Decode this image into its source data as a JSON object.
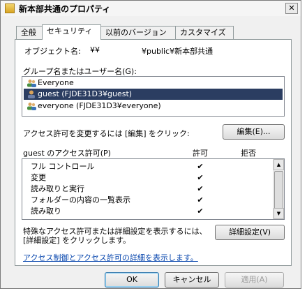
{
  "window": {
    "title": "新本部共通のプロパティ",
    "close_glyph": "✕"
  },
  "tabs": [
    {
      "label": "全般"
    },
    {
      "label": "セキュリティ"
    },
    {
      "label": "以前のバージョン"
    },
    {
      "label": "カスタマイズ"
    }
  ],
  "security": {
    "object_label": "オブジェクト名:",
    "object_prefix": "¥¥",
    "object_suffix": "¥public¥新本部共通",
    "groups_label": "グループ名またはユーザー名(G):",
    "groups": [
      {
        "name": "Everyone",
        "selected": false
      },
      {
        "name": "guest (FJDE31D3¥guest)",
        "selected": true
      },
      {
        "name": "everyone (FJDE31D3¥everyone)",
        "selected": false
      }
    ],
    "change_text": "アクセス許可を変更するには [編集] をクリック:",
    "edit_button": "編集(E)...",
    "permissions_label": "guest のアクセス許可(P)",
    "allow_header": "許可",
    "deny_header": "拒否",
    "permissions": [
      {
        "name": "フル コントロール",
        "allow": "✔",
        "deny": ""
      },
      {
        "name": "変更",
        "allow": "✔",
        "deny": ""
      },
      {
        "name": "読み取りと実行",
        "allow": "✔",
        "deny": ""
      },
      {
        "name": "フォルダーの内容の一覧表示",
        "allow": "✔",
        "deny": ""
      },
      {
        "name": "読み取り",
        "allow": "✔",
        "deny": ""
      }
    ],
    "advanced_text_line1": "特殊なアクセス許可または詳細設定を表示するには、",
    "advanced_text_line2": "[詳細設定] をクリックします。",
    "advanced_button": "詳細設定(V)",
    "help_link": "アクセス制御とアクセス許可の詳細を表示します。"
  },
  "footer": {
    "ok": "OK",
    "cancel": "キャンセル",
    "apply": "適用(A)"
  },
  "colors": {
    "selection": "#2b3d61",
    "link": "#0645ad"
  }
}
